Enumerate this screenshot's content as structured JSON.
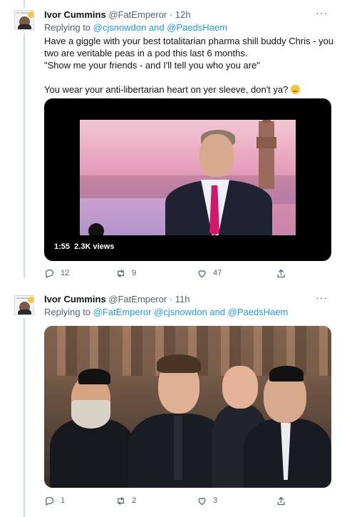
{
  "tweets": [
    {
      "author": {
        "display_name": "Ivor Cummins",
        "handle": "@FatEmperor",
        "time": "12h",
        "avatar_text": "Ivor Cummins"
      },
      "reply_prefix": "Replying to",
      "reply_to": "@cjsnowdon and @PaedsHaem",
      "text_lines": [
        "Have a giggle with your best totalitarian pharma shill buddy Chris - you",
        "two are veritable peas in a pod this last 6 months.",
        "\"Show me your friends - and I'll tell you who you are\"",
        "",
        "You wear your anti-libertarian heart on yer sleeve, don't ya?"
      ],
      "emoji_icon": "winking-face-emoji",
      "media": {
        "type": "video",
        "duration": "1:55",
        "views": "2.3K views"
      },
      "actions": {
        "replies": "12",
        "retweets": "9",
        "likes": "47"
      }
    },
    {
      "author": {
        "display_name": "Ivor Cummins",
        "handle": "@FatEmperor",
        "time": "11h",
        "avatar_text": "Ivor Cummins"
      },
      "reply_prefix": "Replying to",
      "reply_to": "@FatEmperor @cjsnowdon and @PaedsHaem",
      "text_lines": [],
      "media": {
        "type": "photo"
      },
      "actions": {
        "replies": "1",
        "retweets": "2",
        "likes": "3"
      }
    }
  ],
  "icons": {
    "more": "more-horizontal-icon",
    "reply": "reply-icon",
    "retweet": "retweet-icon",
    "like": "heart-icon",
    "share": "share-icon"
  },
  "colors": {
    "link": "#1d9bf0",
    "secondary_text": "#536471",
    "primary_text": "#0f1419",
    "thread_line": "#cfd9de"
  }
}
